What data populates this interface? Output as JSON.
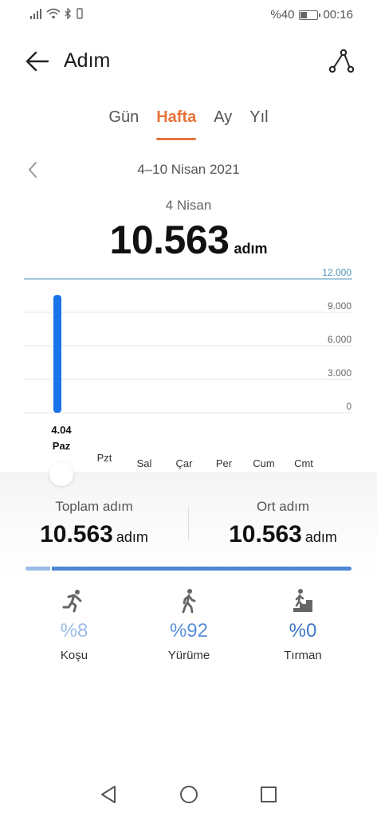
{
  "status_bar": {
    "battery_text": "%40",
    "time": "00:16",
    "battery_level": 0.4
  },
  "header": {
    "title": "Adım"
  },
  "tabs": [
    {
      "label": "Gün",
      "active": false
    },
    {
      "label": "Hafta",
      "active": true
    },
    {
      "label": "Ay",
      "active": false
    },
    {
      "label": "Yıl",
      "active": false
    }
  ],
  "range": {
    "label": "4–10 Nisan 2021"
  },
  "selected": {
    "date": "4 Nisan",
    "value": "10.563",
    "unit": "adım"
  },
  "chart_data": {
    "type": "bar",
    "categories": [
      "Paz",
      "Pzt",
      "Sal",
      "Çar",
      "Per",
      "Cum",
      "Cmt"
    ],
    "values": [
      10563,
      0,
      0,
      0,
      0,
      0,
      0
    ],
    "selected_index": 0,
    "selected_date_label": "4.04",
    "yticks": [
      "12.000",
      "9.000",
      "6.000",
      "3.000",
      "0"
    ],
    "ytick_values": [
      12000,
      9000,
      6000,
      3000,
      0
    ],
    "ylim": [
      0,
      12000
    ],
    "bar_color": "#1a73e8",
    "max_line_color": "#4a90b8"
  },
  "stats": {
    "total_label": "Toplam adım",
    "total_value": "10.563",
    "total_unit": "adım",
    "avg_label": "Ort adım",
    "avg_value": "10.563",
    "avg_unit": "adım"
  },
  "distribution": [
    {
      "pct": "%8",
      "label": "Koşu",
      "fraction": 0.08,
      "color": "#9cbce8",
      "icon": "running-icon"
    },
    {
      "pct": "%92",
      "label": "Yürüme",
      "fraction": 0.92,
      "color": "#5b8fd8",
      "icon": "walking-icon"
    },
    {
      "pct": "%0",
      "label": "Tırman",
      "fraction": 0.0,
      "color": "#3f78c8",
      "icon": "climbing-icon"
    }
  ],
  "colors": {
    "accent": "#e8743b",
    "bar": "#1a73e8"
  }
}
